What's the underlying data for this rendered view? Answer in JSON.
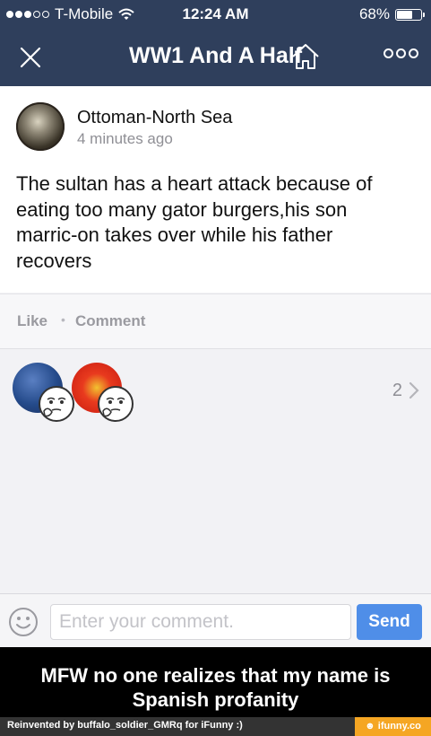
{
  "status_bar": {
    "carrier": "T-Mobile",
    "time": "12:24 AM",
    "battery_percent": "68%",
    "battery_level": 0.68,
    "signal_icon": "signal-dots-icon",
    "wifi_icon": "wifi-icon"
  },
  "nav": {
    "title": "WW1 And A Half",
    "close_icon": "close-icon",
    "home_icon": "home-icon",
    "more_icon": "more-icon"
  },
  "post": {
    "author": "Ottoman-North Sea",
    "time_ago": "4 minutes ago",
    "text": "The sultan has a heart attack because of eating too many gator burgers,his son marric-on takes over while his father recovers"
  },
  "actions": {
    "like": "Like",
    "separator": "•",
    "comment": "Comment"
  },
  "likers": {
    "count": "2"
  },
  "compose": {
    "placeholder": "Enter your comment.",
    "send": "Send",
    "emoji_icon": "smiley-icon"
  },
  "caption": {
    "text": "MFW no one realizes that my name is Spanish profanity"
  },
  "footer": {
    "credit": "Reinvented by buffalo_soldier_GMRq for iFunny :)",
    "brand": "☻ ifunny.co"
  },
  "colors": {
    "nav_bg": "#2f3f5c",
    "send_button": "#4f8ee8",
    "brand_orange": "#f5a623"
  }
}
